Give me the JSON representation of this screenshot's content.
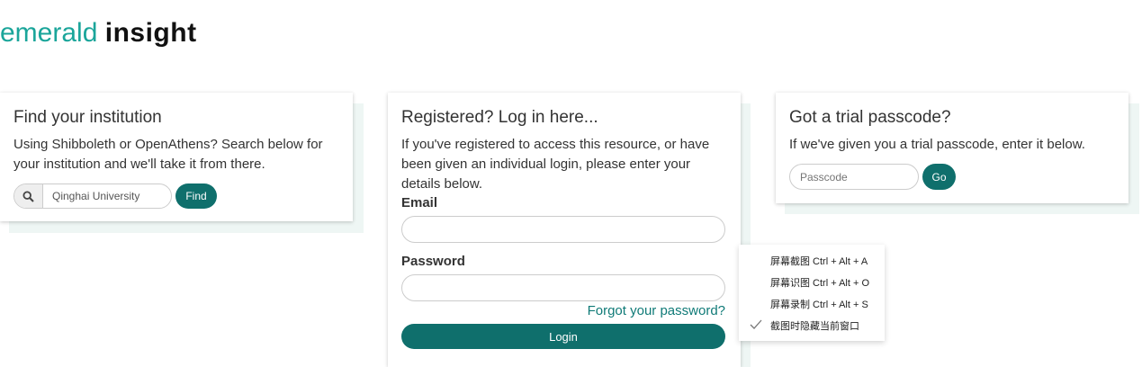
{
  "logo": {
    "part1": "emerald",
    "part2": "insight"
  },
  "institution": {
    "title": "Find your institution",
    "description": "Using Shibboleth or OpenAthens? Search below for your institution and we'll take it from there.",
    "search_value": "Qinghai University",
    "find_label": "Find"
  },
  "login": {
    "title": "Registered? Log in here...",
    "description": "If you've registered to access this resource, or have been given an individual login, please enter your details below.",
    "email_label": "Email",
    "password_label": "Password",
    "forgot_label": "Forgot your password?",
    "login_label": "Login"
  },
  "trial": {
    "title": "Got a trial passcode?",
    "description": "If we've given you a trial passcode, enter it below.",
    "passcode_placeholder": "Passcode",
    "go_label": "Go"
  },
  "context_menu": {
    "items": [
      "屏幕截图 Ctrl + Alt + A",
      "屏幕识图 Ctrl + Alt + O",
      "屏幕录制 Ctrl + Alt + S",
      "截图时隐藏当前窗口"
    ],
    "checked_index": 3
  },
  "colors": {
    "brand_teal": "#0f6f6c",
    "logo_teal": "#1aa59a"
  }
}
